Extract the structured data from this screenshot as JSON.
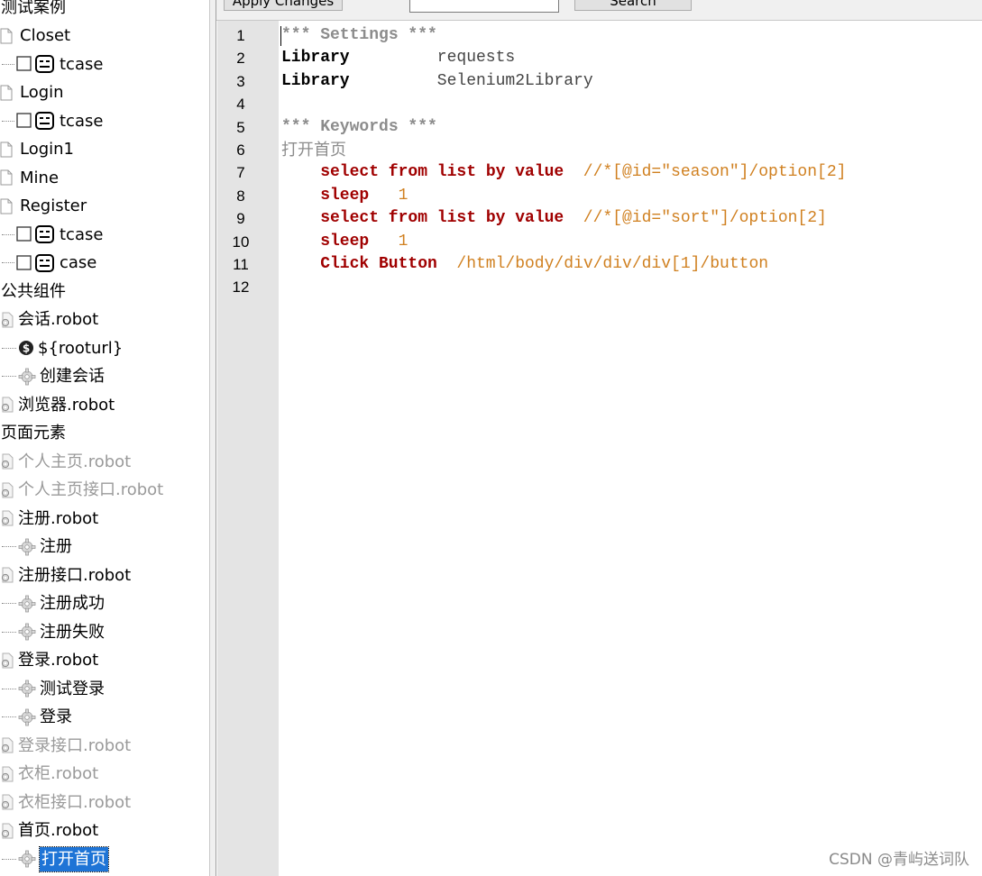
{
  "toolbar": {
    "apply_label": "Apply Changes",
    "search_label": "Search",
    "search_value": ""
  },
  "tree": {
    "items": [
      {
        "label": "测试案例",
        "kind": "section",
        "icon": "none"
      },
      {
        "label": "Closet",
        "kind": "file",
        "icon": "page-icon"
      },
      {
        "label": "tcase",
        "kind": "test",
        "icon": "robot-icon"
      },
      {
        "label": "Login",
        "kind": "file",
        "icon": "page-icon"
      },
      {
        "label": "tcase",
        "kind": "test",
        "icon": "robot-icon"
      },
      {
        "label": "Login1",
        "kind": "file",
        "icon": "page-icon"
      },
      {
        "label": "Mine",
        "kind": "file",
        "icon": "page-icon"
      },
      {
        "label": "Register",
        "kind": "file",
        "icon": "page-icon"
      },
      {
        "label": "tcase",
        "kind": "test",
        "icon": "robot-icon"
      },
      {
        "label": "case",
        "kind": "test",
        "icon": "robot-icon"
      },
      {
        "label": "公共组件",
        "kind": "section",
        "icon": "none"
      },
      {
        "label": "会话.robot",
        "kind": "resource",
        "icon": "gear-file-icon"
      },
      {
        "label": "${rooturl}",
        "kind": "variable",
        "icon": "dollar-icon"
      },
      {
        "label": "创建会话",
        "kind": "keyword",
        "icon": "gear-icon"
      },
      {
        "label": "浏览器.robot",
        "kind": "resource",
        "icon": "gear-file-icon"
      },
      {
        "label": "页面元素",
        "kind": "section",
        "icon": "none"
      },
      {
        "label": "个人主页.robot",
        "kind": "resource-disabled",
        "icon": "gear-file-icon"
      },
      {
        "label": "个人主页接口.robot",
        "kind": "resource-disabled",
        "icon": "gear-file-icon"
      },
      {
        "label": "注册.robot",
        "kind": "resource",
        "icon": "gear-file-icon"
      },
      {
        "label": "注册",
        "kind": "keyword",
        "icon": "gear-icon"
      },
      {
        "label": "注册接口.robot",
        "kind": "resource",
        "icon": "gear-file-icon"
      },
      {
        "label": "注册成功",
        "kind": "keyword",
        "icon": "gear-icon"
      },
      {
        "label": "注册失败",
        "kind": "keyword",
        "icon": "gear-icon"
      },
      {
        "label": "登录.robot",
        "kind": "resource",
        "icon": "gear-file-icon"
      },
      {
        "label": "测试登录",
        "kind": "keyword",
        "icon": "gear-icon"
      },
      {
        "label": "登录",
        "kind": "keyword",
        "icon": "gear-icon"
      },
      {
        "label": "登录接口.robot",
        "kind": "resource-disabled",
        "icon": "gear-file-icon"
      },
      {
        "label": "衣柜.robot",
        "kind": "resource-disabled",
        "icon": "gear-file-icon"
      },
      {
        "label": "衣柜接口.robot",
        "kind": "resource-disabled",
        "icon": "gear-file-icon"
      },
      {
        "label": "首页.robot",
        "kind": "resource",
        "icon": "gear-file-icon"
      },
      {
        "label": "打开首页",
        "kind": "keyword-selected",
        "icon": "gear-icon"
      }
    ]
  },
  "editor": {
    "lines": [
      {
        "num": "1",
        "segs": [
          {
            "t": "*** Settings ***",
            "c": "comment",
            "col": 0
          }
        ]
      },
      {
        "num": "2",
        "segs": [
          {
            "t": "Library",
            "c": "setting",
            "col": 0
          },
          {
            "t": "requests",
            "c": "arg",
            "col": 16
          }
        ]
      },
      {
        "num": "3",
        "segs": [
          {
            "t": "Library",
            "c": "setting",
            "col": 0
          },
          {
            "t": "Selenium2Library",
            "c": "arg",
            "col": 16
          }
        ]
      },
      {
        "num": "4",
        "segs": []
      },
      {
        "num": "5",
        "segs": [
          {
            "t": "*** Keywords ***",
            "c": "comment",
            "col": 0
          }
        ]
      },
      {
        "num": "6",
        "segs": [
          {
            "t": "打开首页",
            "c": "kwname",
            "col": 0
          }
        ]
      },
      {
        "num": "7",
        "segs": [
          {
            "t": "select from list by value",
            "c": "kw",
            "col": 4
          },
          {
            "t": "//*[@id=\"season\"]/option[2]",
            "c": "val",
            "col": 31
          }
        ]
      },
      {
        "num": "8",
        "segs": [
          {
            "t": "sleep",
            "c": "kw",
            "col": 4
          },
          {
            "t": "1",
            "c": "val",
            "col": 12
          }
        ]
      },
      {
        "num": "9",
        "segs": [
          {
            "t": "select from list by value",
            "c": "kw",
            "col": 4
          },
          {
            "t": "//*[@id=\"sort\"]/option[2]",
            "c": "val",
            "col": 31
          }
        ]
      },
      {
        "num": "10",
        "segs": [
          {
            "t": "sleep",
            "c": "kw",
            "col": 4
          },
          {
            "t": "1",
            "c": "val",
            "col": 12
          }
        ]
      },
      {
        "num": "11",
        "segs": [
          {
            "t": "Click Button",
            "c": "kw",
            "col": 4
          },
          {
            "t": "/html/body/div/div/div[1]/button",
            "c": "val",
            "col": 18
          }
        ]
      },
      {
        "num": "12",
        "segs": []
      }
    ]
  },
  "watermark": "CSDN @青屿送词队",
  "colors": {
    "selection": "#1e74d6",
    "keyword": "#a00000",
    "value": "#d08020",
    "comment": "#8c8c8c"
  }
}
